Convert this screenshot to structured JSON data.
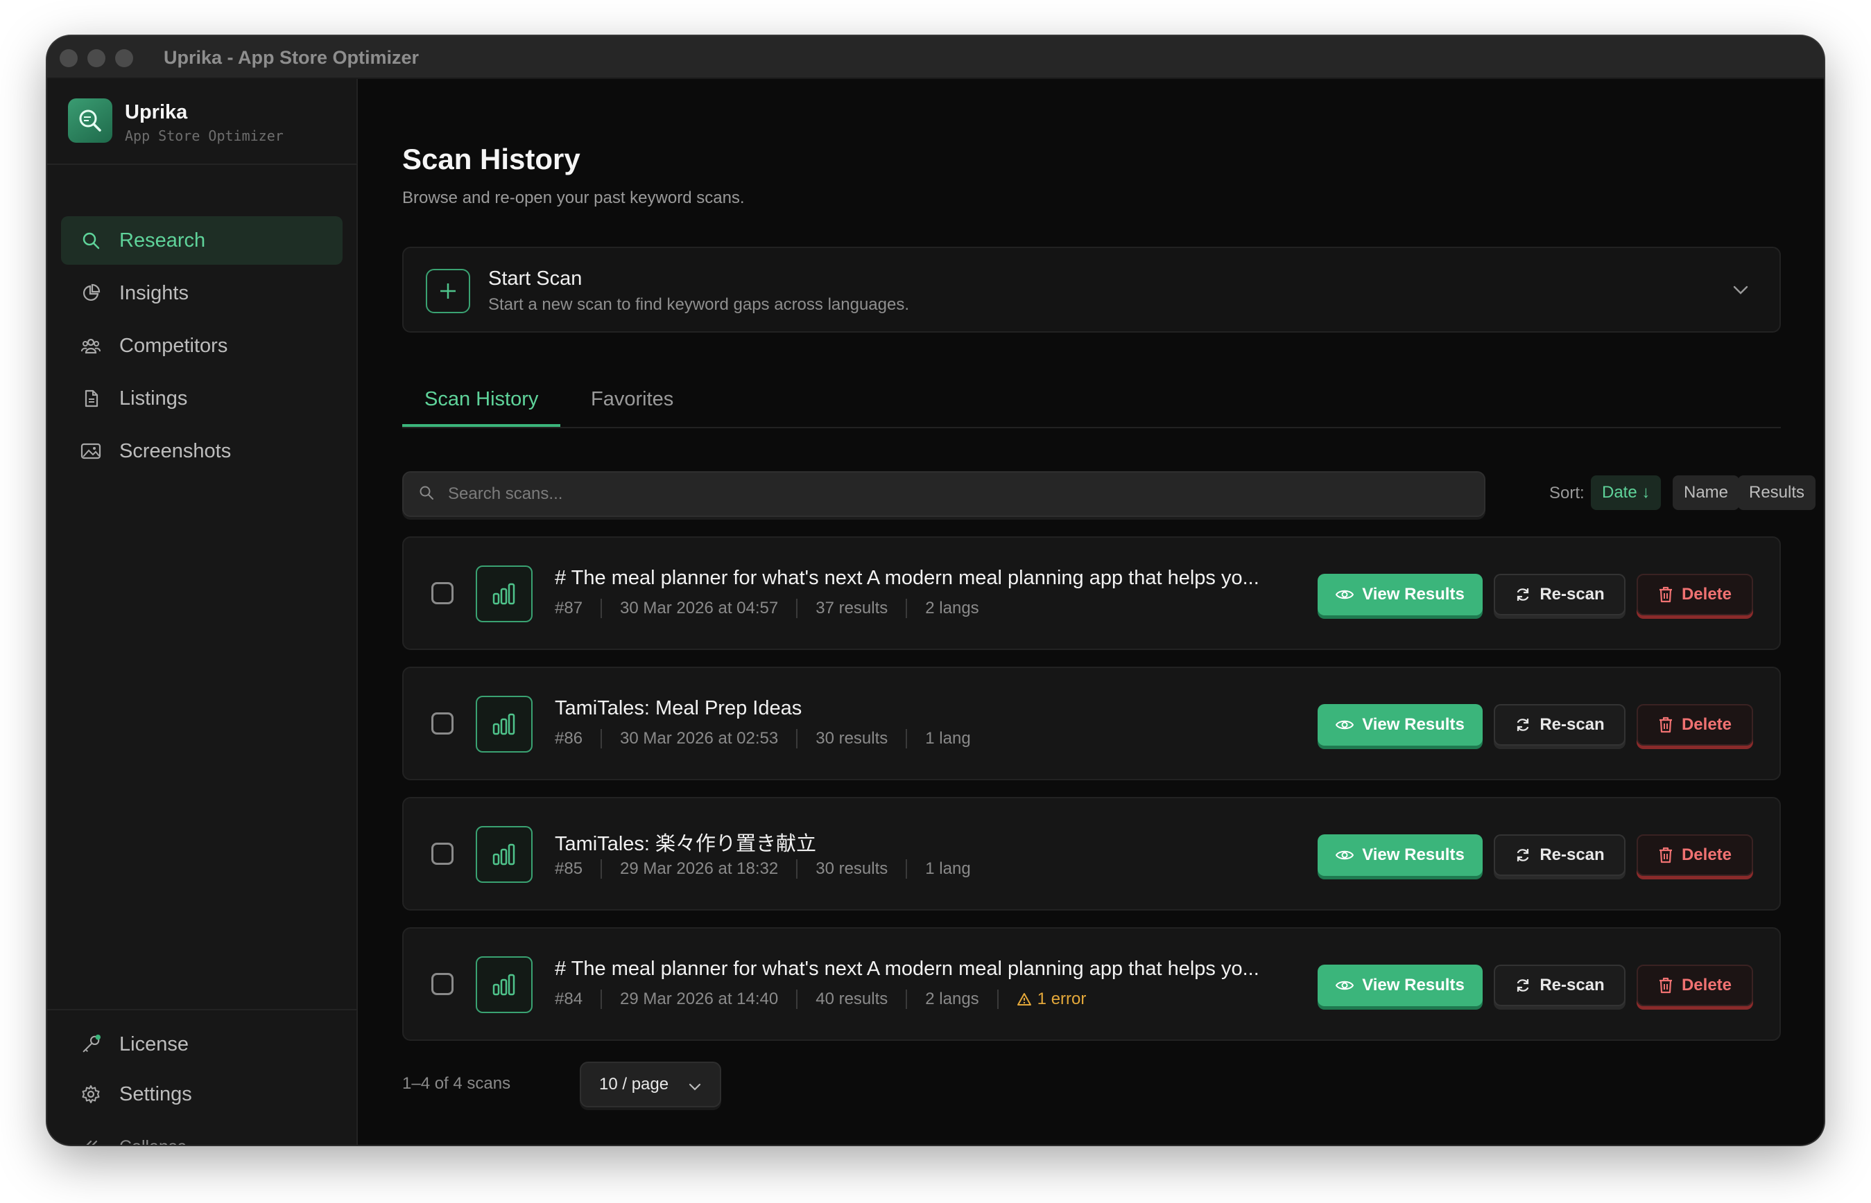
{
  "window": {
    "title": "Uprika - App Store Optimizer"
  },
  "brand": {
    "name": "Uprika",
    "subtitle": "App Store Optimizer",
    "logo_icon": "search-logo-icon"
  },
  "sidebar": {
    "items": [
      {
        "label": "Research",
        "icon": "search-icon",
        "active": true
      },
      {
        "label": "Insights",
        "icon": "pie-chart-icon",
        "active": false
      },
      {
        "label": "Competitors",
        "icon": "users-icon",
        "active": false
      },
      {
        "label": "Listings",
        "icon": "document-icon",
        "active": false
      },
      {
        "label": "Screenshots",
        "icon": "image-icon",
        "active": false
      }
    ],
    "footer": {
      "license": "License",
      "settings": "Settings",
      "collapse": "Collapse"
    }
  },
  "page": {
    "title": "Scan History",
    "subtitle": "Browse and re-open your past keyword scans."
  },
  "start_scan": {
    "title": "Start Scan",
    "subtitle": "Start a new scan to find keyword gaps across languages."
  },
  "tabs": [
    {
      "label": "Scan History",
      "active": true
    },
    {
      "label": "Favorites",
      "active": false
    }
  ],
  "search": {
    "placeholder": "Search scans...",
    "value": ""
  },
  "sort": {
    "label": "Sort:",
    "options": [
      {
        "label": "Date ↓",
        "active": true
      },
      {
        "label": "Name",
        "active": false
      },
      {
        "label": "Results",
        "active": false
      }
    ]
  },
  "actions": {
    "view": "View Results",
    "rescan": "Re-scan",
    "delete": "Delete"
  },
  "scans": [
    {
      "title": "# The meal planner for what's next A modern meal planning app that helps yo...",
      "id": "#87",
      "date": "30 Mar 2026 at 04:57",
      "results": "37 results",
      "langs": "2 langs",
      "error": ""
    },
    {
      "title": "TamiTales: Meal Prep Ideas",
      "id": "#86",
      "date": "30 Mar 2026 at 02:53",
      "results": "30 results",
      "langs": "1 lang",
      "error": ""
    },
    {
      "title": "TamiTales: 楽々作り置き献立",
      "id": "#85",
      "date": "29 Mar 2026 at 18:32",
      "results": "30 results",
      "langs": "1 lang",
      "error": ""
    },
    {
      "title": "# The meal planner for what's next A modern meal planning app that helps yo...",
      "id": "#84",
      "date": "29 Mar 2026 at 14:40",
      "results": "40 results",
      "langs": "2 langs",
      "error": "1 error"
    }
  ],
  "pagination": {
    "summary": "1–4 of 4 scans",
    "per_page": "10 / page"
  },
  "colors": {
    "accent": "#3bb57b",
    "danger": "#f07272",
    "warning": "#e4a83a",
    "background": "#0b0b0b",
    "sidebar": "#171717"
  }
}
